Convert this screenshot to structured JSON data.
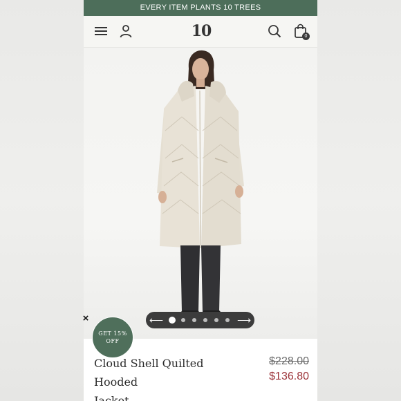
{
  "promo": {
    "text": "EVERY ITEM PLANTS 10 TREES"
  },
  "header": {
    "logo_text": "10",
    "menu_icon": "hamburger-menu-icon",
    "account_icon": "user-icon",
    "search_icon": "search-icon",
    "cart_icon": "shopping-bag-icon",
    "cart_count": "0"
  },
  "gallery": {
    "image_alt": "Model wearing cream quilted hooded long jacket",
    "slide_count": 6,
    "active_slide": 1,
    "prev_icon": "arrow-left-icon",
    "next_icon": "arrow-right-icon"
  },
  "popup": {
    "close_label": "×",
    "discount_line1": "GET 15%",
    "discount_line2": "OFF"
  },
  "product": {
    "title_line1": "Cloud Shell Quilted Hooded",
    "title_line2": "Jacket",
    "original_price": "$228.00",
    "sale_price": "$136.80"
  },
  "colors": {
    "brand_green": "#4d6e5a",
    "sale_red": "#9c3339",
    "jacket_cream": "#e7e1d4"
  }
}
